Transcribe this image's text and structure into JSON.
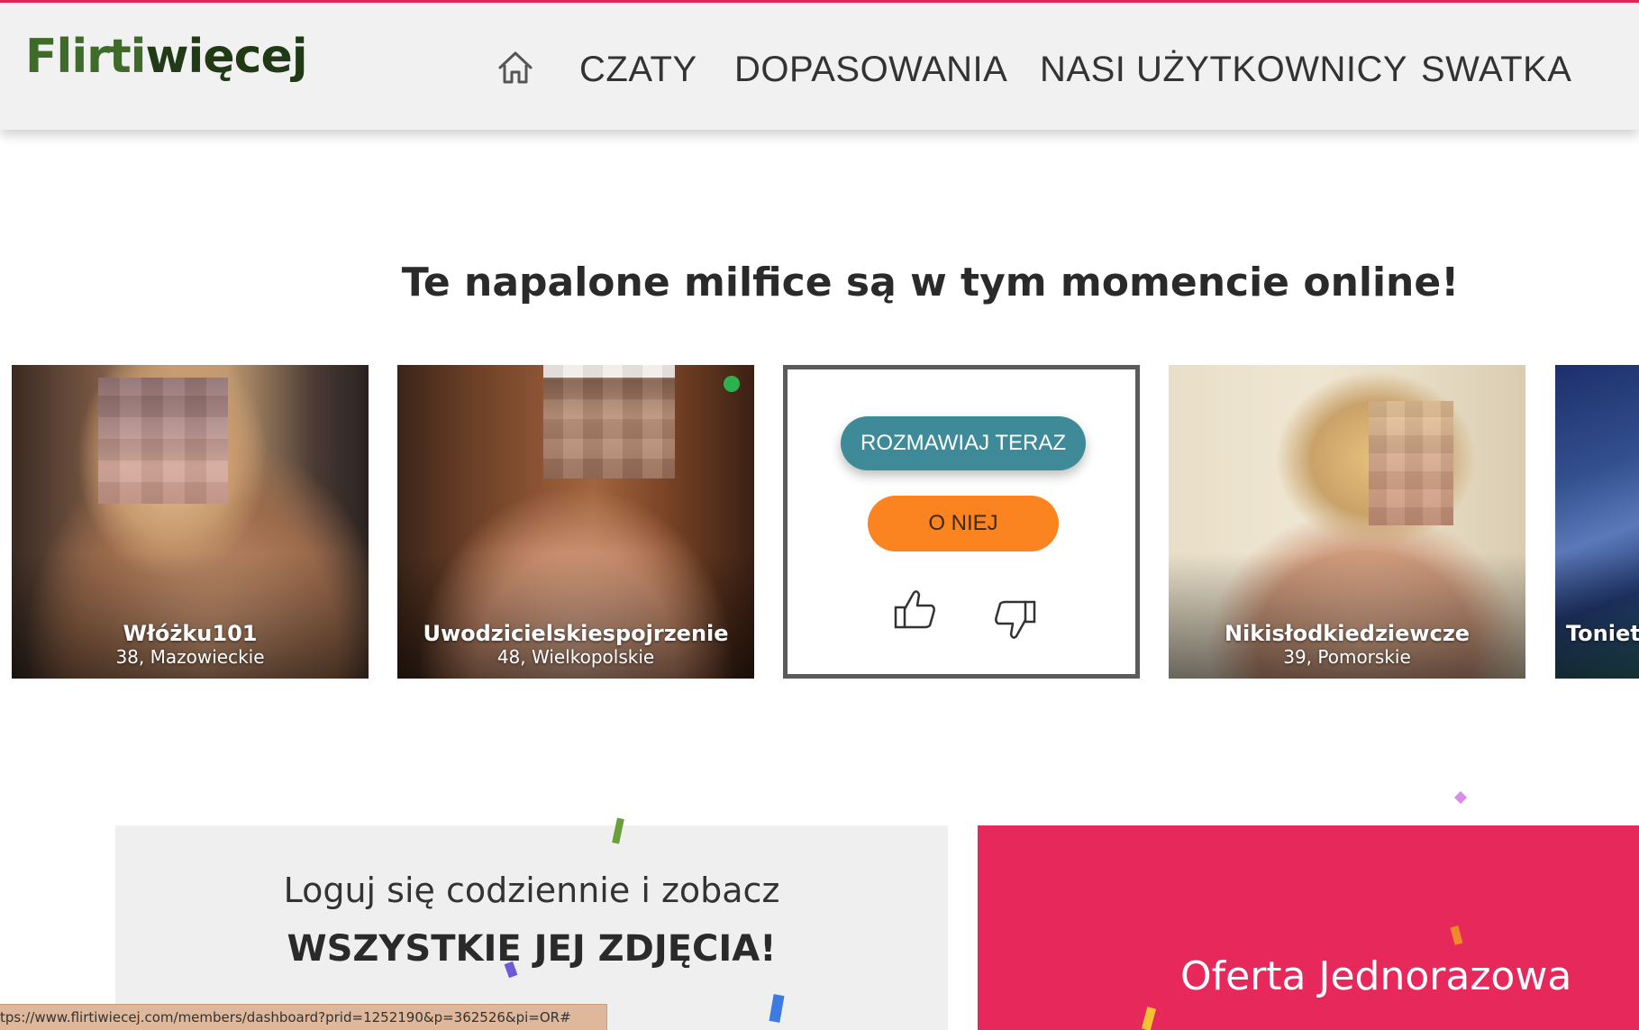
{
  "header": {
    "logo_part1": "Flirti",
    "logo_part2": "więcej",
    "nav": {
      "home_icon": "home-icon",
      "items": [
        "CZATY",
        "DOPASOWANIA",
        "NASI UŻYTKOWNICY",
        "SWATKA"
      ]
    }
  },
  "main": {
    "headline": "Te napalone milfice są w tym momencie online!",
    "profiles": [
      {
        "name": "Włóżku101",
        "meta": "38, Mazowieckie"
      },
      {
        "name": "Uwodzicielskiespojrzenie",
        "meta": "48, Wielkopolskie",
        "online": true
      },
      {
        "name": "Nikisłodkiedziewcze",
        "meta": "39, Pomorskie"
      },
      {
        "name": "Toniet"
      }
    ],
    "action_card": {
      "chat_label": "ROZMAWIAJ TERAZ",
      "about_label": "O NIEJ",
      "like_icon": "thumbs-up-icon",
      "dislike_icon": "thumbs-down-icon"
    }
  },
  "promo": {
    "left_line1": "Loguj się codziennie i zobacz",
    "left_line2": "WSZYSTKIE JEJ ZDJĘCIA!",
    "right_title": "Oferta Jednorazowa"
  },
  "status_url": "tps://www.flirtiwiecej.com/members/dashboard?prid=1252190&p=362526&pi=OR#",
  "colors": {
    "accent_pink": "#e6285b",
    "chat_button": "#3f8a98",
    "about_button": "#fb8320",
    "logo_green": "#3f6b2a"
  }
}
